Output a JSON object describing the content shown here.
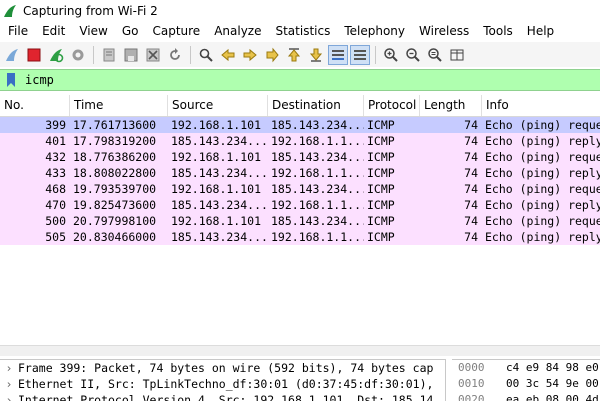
{
  "window": {
    "title": "Capturing from Wi-Fi 2"
  },
  "menu": [
    "File",
    "Edit",
    "View",
    "Go",
    "Capture",
    "Analyze",
    "Statistics",
    "Telephony",
    "Wireless",
    "Tools",
    "Help"
  ],
  "toolbar": {
    "icons": [
      "start-capture-icon",
      "stop-capture-icon",
      "restart-capture-icon",
      "capture-options-icon",
      "open-file-icon",
      "save-file-icon",
      "close-file-icon",
      "reload-icon",
      "find-packet-icon",
      "go-back-icon",
      "go-forward-icon",
      "go-to-packet-icon",
      "go-first-icon",
      "go-last-icon",
      "autoscroll-icon",
      "colorize-icon",
      "zoom-in-icon",
      "zoom-out-icon",
      "normal-size-icon",
      "resize-columns-icon"
    ]
  },
  "filter": {
    "value": "icmp"
  },
  "columns": [
    "No.",
    "Time",
    "Source",
    "Destination",
    "Protocol",
    "Length",
    "Info"
  ],
  "packets": [
    {
      "no": "399",
      "time": "17.761713600",
      "src": "192.168.1.101",
      "dst": "185.143.234...",
      "proto": "ICMP",
      "len": "74",
      "info": "Echo (ping) reque",
      "selected": true
    },
    {
      "no": "401",
      "time": "17.798319200",
      "src": "185.143.234...",
      "dst": "192.168.1.1...",
      "proto": "ICMP",
      "len": "74",
      "info": "Echo (ping) reply"
    },
    {
      "no": "432",
      "time": "18.776386200",
      "src": "192.168.1.101",
      "dst": "185.143.234...",
      "proto": "ICMP",
      "len": "74",
      "info": "Echo (ping) reque"
    },
    {
      "no": "433",
      "time": "18.808022800",
      "src": "185.143.234...",
      "dst": "192.168.1.1...",
      "proto": "ICMP",
      "len": "74",
      "info": "Echo (ping) reply"
    },
    {
      "no": "468",
      "time": "19.793539700",
      "src": "192.168.1.101",
      "dst": "185.143.234...",
      "proto": "ICMP",
      "len": "74",
      "info": "Echo (ping) reque"
    },
    {
      "no": "470",
      "time": "19.825473600",
      "src": "185.143.234...",
      "dst": "192.168.1.1...",
      "proto": "ICMP",
      "len": "74",
      "info": "Echo (ping) reply"
    },
    {
      "no": "500",
      "time": "20.797998100",
      "src": "192.168.1.101",
      "dst": "185.143.234...",
      "proto": "ICMP",
      "len": "74",
      "info": "Echo (ping) reque"
    },
    {
      "no": "505",
      "time": "20.830466000",
      "src": "185.143.234...",
      "dst": "192.168.1.1...",
      "proto": "ICMP",
      "len": "74",
      "info": "Echo (ping) reply"
    }
  ],
  "details": [
    "Frame 399: Packet, 74 bytes on wire (592 bits), 74 bytes cap",
    "Ethernet II, Src: TpLinkTechno_df:30:01 (d0:37:45:df:30:01),",
    "Internet Protocol Version 4, Src: 192.168.1.101, Dst: 185.14"
  ],
  "bytes": [
    {
      "offset": "0000",
      "hex": "c4 e9 84 98 e0"
    },
    {
      "offset": "0010",
      "hex": "00 3c 54 9e 00"
    },
    {
      "offset": "0020",
      "hex": "ea eb 08 00 4d"
    }
  ],
  "colors": {
    "icmp_row": "#fce0ff",
    "selected_row": "#c6cbff",
    "filter_ok": "#afffaf"
  }
}
